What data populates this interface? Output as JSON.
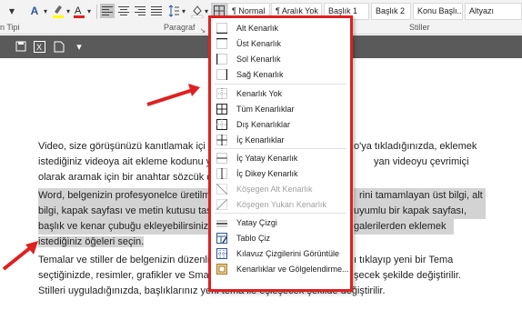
{
  "ribbon": {
    "font_label_partial": "n Tipi",
    "paragraph_group": "Paragraf",
    "styles_group": "Stiller",
    "styles": [
      "¶ Normal",
      "¶ Aralık Yok",
      "Başlık 1",
      "Başlık 2",
      "Konu Başlı...",
      "Altyazı"
    ]
  },
  "menu": {
    "items": [
      {
        "label": "Alt Kenarlık",
        "icon": "border-bottom-icon",
        "disabled": false
      },
      {
        "label": "Üst Kenarlık",
        "icon": "border-top-icon",
        "disabled": false
      },
      {
        "label": "Sol Kenarlık",
        "icon": "border-left-icon",
        "disabled": false
      },
      {
        "label": "Sağ Kenarlık",
        "icon": "border-right-icon",
        "disabled": false
      },
      {
        "label": "Kenarlık Yok",
        "icon": "no-border-icon",
        "disabled": false
      },
      {
        "label": "Tüm Kenarlıklar",
        "icon": "all-borders-icon",
        "disabled": false
      },
      {
        "label": "Dış Kenarlıklar",
        "icon": "outside-borders-icon",
        "disabled": false
      },
      {
        "label": "İç Kenarlıklar",
        "icon": "inside-borders-icon",
        "disabled": false
      },
      {
        "label": "İç Yatay Kenarlık",
        "icon": "inside-horizontal-border-icon",
        "disabled": false
      },
      {
        "label": "İç Dikey Kenarlık",
        "icon": "inside-vertical-border-icon",
        "disabled": false
      },
      {
        "label": "Köşegen Alt Kenarlık",
        "icon": "diagonal-down-border-icon",
        "disabled": true
      },
      {
        "label": "Köşegen Yukarı Kenarlık",
        "icon": "diagonal-up-border-icon",
        "disabled": true
      },
      {
        "label": "Yatay Çizgi",
        "icon": "horizontal-line-icon",
        "disabled": false
      },
      {
        "label": "Tablo Çiz",
        "icon": "draw-table-icon",
        "disabled": false
      },
      {
        "label": "Kılavuz Çizgilerini Görüntüle",
        "icon": "view-gridlines-icon",
        "disabled": false
      },
      {
        "label": "Kenarlıklar ve Gölgelendirme...",
        "icon": "borders-shading-icon",
        "disabled": false
      }
    ]
  },
  "document": {
    "p1": [
      "Video, size görüşünüzü kanıtlamak içi",
      "istediğiniz videoya ait ekleme kodunu y",
      "olarak aramak için bir anahtar sözcük d"
    ],
    "p1_right": [
      "o'ya tıkladığınızda, eklemek",
      "yan videoyu çevrimiçi",
      ""
    ],
    "p2": [
      "Word, belgenizin profesyonelce üretilm",
      "bilgi, kapak sayfası ve metin kutusu tasa",
      "başlık ve kenar çubuğu ekleyebilirsiniz.",
      "istediğiniz öğeleri seçin."
    ],
    "p2_right": [
      "rini tamamlayan üst bilgi, alt",
      "uyumlu bir kapak sayfası,",
      "galerilerden eklemek",
      ""
    ],
    "p3": [
      "Temalar ve stiller de belgenizin düzenli",
      "seçtiğinizde, resimler, grafikler ve Smar",
      "Stilleri uyguladığınızda, başlıklarınız yeni tema ile eşleşecek şekilde değiştirilir."
    ],
    "p3_right": [
      "ı tıklayıp yeni bir Tema",
      "şecek şekilde değiştirilir.",
      ""
    ]
  },
  "colors": {
    "accent_red": "#e02020",
    "selection_gray": "#d3d3d3",
    "qa_bar": "#5a5a5a"
  }
}
